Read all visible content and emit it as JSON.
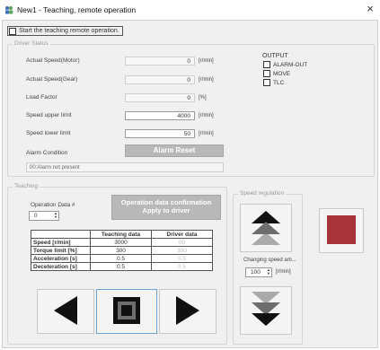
{
  "window": {
    "title": "New1 - Teaching, remote operation",
    "close_glyph": "×",
    "icon": "teaching-app-icon"
  },
  "start_checkbox": {
    "label": "Start the teaching remote operation.",
    "checked": false
  },
  "driver_status": {
    "title": "Driver Status",
    "rows": [
      {
        "label": "Actual Speed(Motor)",
        "value": "0",
        "unit": "[r/min]"
      },
      {
        "label": "Actual Speed(Gear)",
        "value": "0",
        "unit": "[r/min]"
      },
      {
        "label": "Load Factor",
        "value": "0",
        "unit": "[%]"
      },
      {
        "label": "Speed upper limit",
        "value": "4000",
        "unit": "[r/min]"
      },
      {
        "label": "Speed lower limit",
        "value": "50",
        "unit": "[r/min]"
      }
    ],
    "output": {
      "title": "OUTPUT",
      "items": [
        {
          "label": "ALARM-OUT",
          "checked": false
        },
        {
          "label": "MOVE",
          "checked": false
        },
        {
          "label": "TLC",
          "checked": false
        }
      ]
    },
    "alarm_condition_label": "Alarm Condition",
    "alarm_reset_label": "Alarm Reset",
    "alarm_message": "00:Alarm not present"
  },
  "teaching": {
    "title": "Teaching",
    "operation_data_label": "Operation Data #",
    "operation_data_value": "0",
    "confirm_button_line1": "Operation data confirmation",
    "confirm_button_line2": "Apply to driver",
    "table": {
      "headers": [
        "",
        "Teaching data",
        "Driver data"
      ],
      "rows": [
        {
          "label": "Speed [r/min]",
          "teaching": "3000",
          "driver": "00"
        },
        {
          "label": "Torque limit [%]",
          "teaching": "300",
          "driver": "300"
        },
        {
          "label": "Acceleration [s]",
          "teaching": "0.5",
          "driver": "0.5"
        },
        {
          "label": "Deceleration [s]",
          "teaching": "0.5",
          "driver": "0.5"
        }
      ]
    }
  },
  "speed_regulation": {
    "title": "Speed regulation",
    "changing_label": "Changing  speed am...",
    "changing_value": "100",
    "changing_unit": "[r/min]"
  },
  "colors": {
    "stop_red": "#a9333a",
    "arrow_black": "#111111",
    "arrow_gray": "#6e6e6e"
  }
}
